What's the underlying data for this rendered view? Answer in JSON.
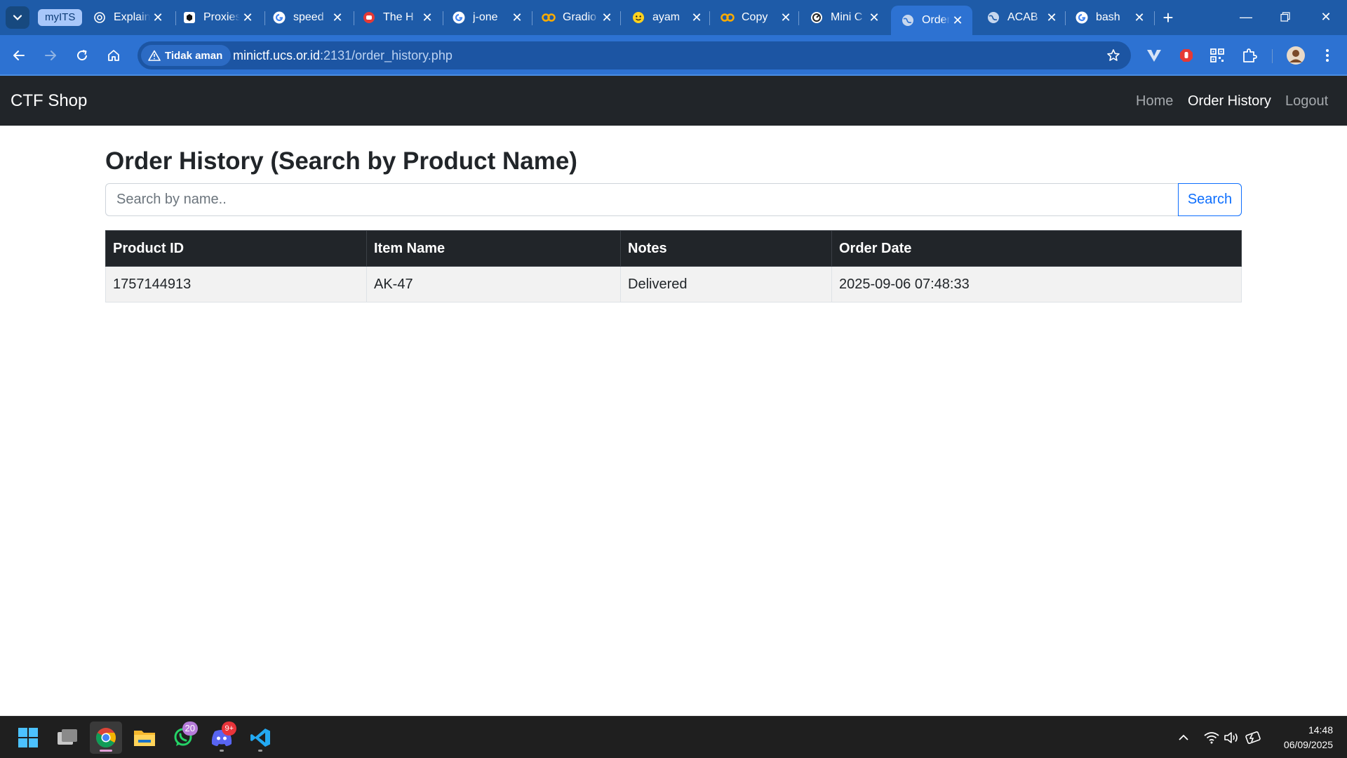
{
  "browser": {
    "tab_group_label": "myITS",
    "tabs": [
      {
        "title": "Explain",
        "icon": "openai-icon"
      },
      {
        "title": "Proxies",
        "icon": "proxies-icon"
      },
      {
        "title": "speed",
        "icon": "google-icon"
      },
      {
        "title": "The H",
        "icon": "red-speech-icon"
      },
      {
        "title": "j-one",
        "icon": "google-icon"
      },
      {
        "title": "Gradio",
        "icon": "colab-icon"
      },
      {
        "title": "ayam",
        "icon": "huggingface-icon"
      },
      {
        "title": "Copy",
        "icon": "colab-icon"
      },
      {
        "title": "Mini C",
        "icon": "ctf-icon"
      },
      {
        "title": "Order",
        "icon": "globe-icon",
        "active": true
      },
      {
        "title": "ACAB",
        "icon": "globe-icon"
      },
      {
        "title": "bash",
        "icon": "google-icon"
      }
    ],
    "security_label": "Tidak aman",
    "url_host": "minictf.ucs.or.id",
    "url_rest": ":2131/order_history.php"
  },
  "navbar": {
    "brand": "CTF Shop",
    "links": [
      "Home",
      "Order History",
      "Logout"
    ]
  },
  "main": {
    "title": "Order History (Search by Product Name)",
    "search_placeholder": "Search by name..",
    "search_button": "Search",
    "table": {
      "headers": [
        "Product ID",
        "Item Name",
        "Notes",
        "Order Date"
      ],
      "rows": [
        [
          "1757144913",
          "AK-47",
          "Delivered",
          "2025-09-06 07:48:33"
        ]
      ]
    }
  },
  "taskbar": {
    "whatsapp_badge": "20",
    "discord_badge": "9+",
    "time": "14:48",
    "date": "06/09/2025"
  },
  "colors": {
    "chrome_frame": "#1e5ba8",
    "chrome_toolbar": "#2d72d2",
    "navbar_bg": "#212529",
    "primary": "#0d6efd"
  }
}
